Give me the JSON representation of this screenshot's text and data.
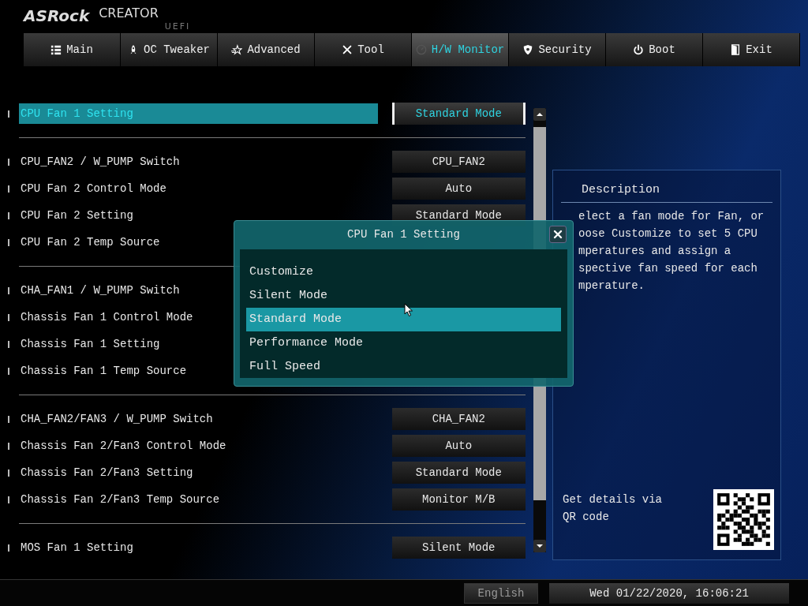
{
  "header": {
    "brand": "ASRock",
    "product": "CREATOR",
    "edition": "UEFI"
  },
  "tabs": [
    {
      "label": "Main",
      "selected": false
    },
    {
      "label": "OC Tweaker",
      "selected": false
    },
    {
      "label": "Advanced",
      "selected": false
    },
    {
      "label": "Tool",
      "selected": false
    },
    {
      "label": "H/W Monitor",
      "selected": true
    },
    {
      "label": "Security",
      "selected": false
    },
    {
      "label": "Boot",
      "selected": false
    },
    {
      "label": "Exit",
      "selected": false
    }
  ],
  "sections": [
    {
      "items": [
        {
          "label": "CPU Fan 1 Setting",
          "value": "Standard Mode",
          "selected": true
        }
      ]
    },
    {
      "items": [
        {
          "label": "CPU_FAN2 / W_PUMP Switch",
          "value": "CPU_FAN2",
          "selected": false
        },
        {
          "label": "CPU Fan 2 Control Mode",
          "value": "Auto",
          "selected": false
        },
        {
          "label": "CPU Fan 2 Setting",
          "value": "Standard Mode",
          "selected": false
        },
        {
          "label": "CPU Fan 2 Temp Source",
          "selected": false
        }
      ]
    },
    {
      "items": [
        {
          "label": "CHA_FAN1 / W_PUMP Switch",
          "selected": false
        },
        {
          "label": "Chassis Fan 1 Control Mode",
          "selected": false
        },
        {
          "label": "Chassis Fan 1 Setting",
          "selected": false
        },
        {
          "label": "Chassis Fan 1 Temp Source",
          "selected": false
        }
      ]
    },
    {
      "items": [
        {
          "label": "CHA_FAN2/FAN3 / W_PUMP Switch",
          "value": "CHA_FAN2",
          "selected": false
        },
        {
          "label": "Chassis Fan 2/Fan3 Control Mode",
          "value": "Auto",
          "selected": false
        },
        {
          "label": "Chassis Fan 2/Fan3 Setting",
          "value": "Standard Mode",
          "selected": false
        },
        {
          "label": "Chassis Fan 2/Fan3 Temp Source",
          "value": "Monitor M/B",
          "selected": false
        }
      ]
    },
    {
      "items": [
        {
          "label": "MOS Fan 1 Setting",
          "value": "Silent Mode",
          "selected": false
        }
      ]
    }
  ],
  "description": {
    "title": "Description",
    "lines": [
      "elect a fan mode for Fan, or",
      "oose Customize to set 5 CPU",
      "mperatures and assign a",
      "spective fan speed for each",
      "mperature."
    ],
    "qr_caption": "Get details via QR code"
  },
  "popup": {
    "title": "CPU Fan 1 Setting",
    "options": [
      {
        "label": "Customize",
        "selected": false
      },
      {
        "label": "Silent Mode",
        "selected": false
      },
      {
        "label": "Standard Mode",
        "selected": true
      },
      {
        "label": "Performance Mode",
        "selected": false
      },
      {
        "label": "Full Speed",
        "selected": false
      }
    ]
  },
  "status_bar": {
    "language": "English",
    "datetime": "Wed 01/22/2020, 16:06:21"
  }
}
